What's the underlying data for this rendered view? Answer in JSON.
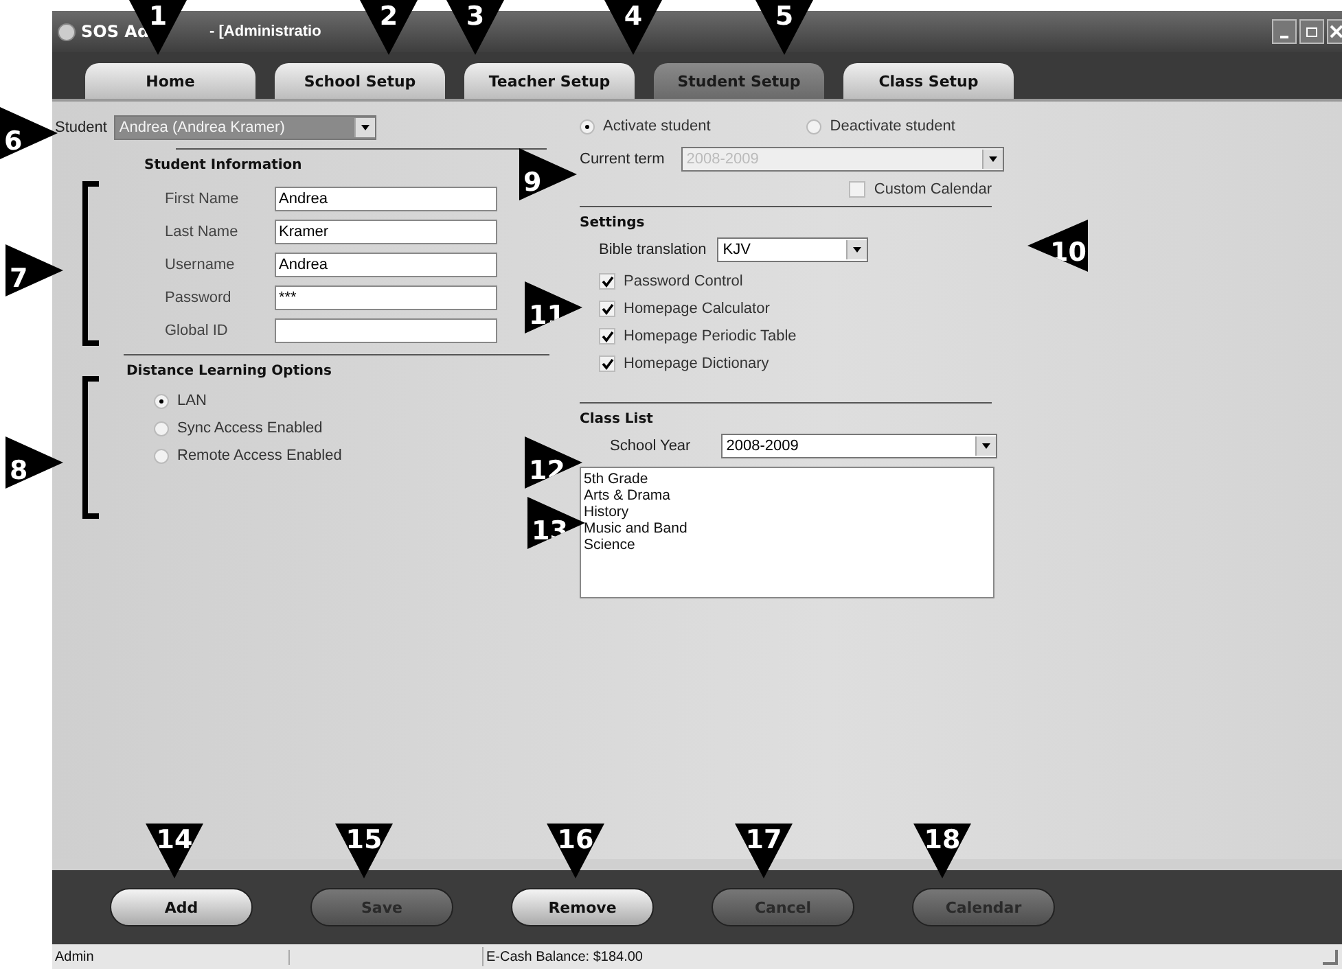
{
  "window": {
    "title_start": "SOS Ad",
    "title_end": "- [Administratio"
  },
  "tabs": [
    {
      "label": "Home",
      "selected": false
    },
    {
      "label": "School Setup",
      "selected": false
    },
    {
      "label": "Teacher Setup",
      "selected": false
    },
    {
      "label": "Student Setup",
      "selected": true
    },
    {
      "label": "Class Setup",
      "selected": false
    }
  ],
  "student": {
    "label": "Student",
    "value": "Andrea    (Andrea Kramer)"
  },
  "student_information": {
    "title": "Student Information",
    "fields": [
      {
        "label": "First Name",
        "value": "Andrea"
      },
      {
        "label": "Last Name",
        "value": "Kramer"
      },
      {
        "label": "Username",
        "value": "Andrea"
      },
      {
        "label": "Password",
        "value": "***"
      },
      {
        "label": "Global ID"
      }
    ]
  },
  "distance_learning": {
    "title": "Distance Learning Options",
    "options": [
      {
        "label": "LAN",
        "selected": true
      },
      {
        "label": "Sync Access Enabled",
        "selected": false
      },
      {
        "label": "Remote Access Enabled",
        "selected": false
      }
    ]
  },
  "activation": [
    {
      "label": "Activate student",
      "selected": true
    },
    {
      "label": "Deactivate student",
      "selected": false
    }
  ],
  "current_term": {
    "label": "Current term",
    "value": "2008-2009",
    "disabled": true
  },
  "custom_calendar": {
    "label": "Custom Calendar",
    "checked": false
  },
  "settings": {
    "title": "Settings",
    "bible_translation": {
      "label": "Bible translation",
      "value": "KJV"
    },
    "options": [
      {
        "label": "Password Control",
        "checked": true
      },
      {
        "label": "Homepage Calculator",
        "checked": true
      },
      {
        "label": "Homepage Periodic Table",
        "checked": true
      },
      {
        "label": "Homepage Dictionary",
        "checked": true
      }
    ]
  },
  "class_list": {
    "title": "Class List",
    "school_year": {
      "label": "School Year",
      "value": "2008-2009"
    },
    "items": [
      "5th Grade",
      "Arts & Drama",
      "History",
      "Music and Band",
      "Science"
    ]
  },
  "buttons": [
    {
      "label": "Add",
      "disabled": false
    },
    {
      "label": "Save",
      "disabled": true
    },
    {
      "label": "Remove",
      "disabled": false
    },
    {
      "label": "Cancel",
      "disabled": true
    },
    {
      "label": "Calendar",
      "disabled": true
    }
  ],
  "status_bar": {
    "user": "Admin",
    "balance": "E-Cash Balance: $184.00"
  },
  "callouts": [
    {
      "number": "1",
      "kind": "down"
    },
    {
      "number": "2",
      "kind": "down"
    },
    {
      "number": "3",
      "kind": "down"
    },
    {
      "number": "4",
      "kind": "down"
    },
    {
      "number": "5",
      "kind": "down"
    },
    {
      "number": "6",
      "kind": "right"
    },
    {
      "number": "7",
      "kind": "right"
    },
    {
      "number": "8",
      "kind": "right"
    },
    {
      "number": "9",
      "kind": "right"
    },
    {
      "number": "10",
      "kind": "left"
    },
    {
      "number": "11",
      "kind": "right"
    },
    {
      "number": "12",
      "kind": "right"
    },
    {
      "number": "13",
      "kind": "right"
    },
    {
      "number": "14",
      "kind": "down"
    },
    {
      "number": "15",
      "kind": "down"
    },
    {
      "number": "16",
      "kind": "down"
    },
    {
      "number": "17",
      "kind": "down"
    },
    {
      "number": "18",
      "kind": "down"
    }
  ]
}
